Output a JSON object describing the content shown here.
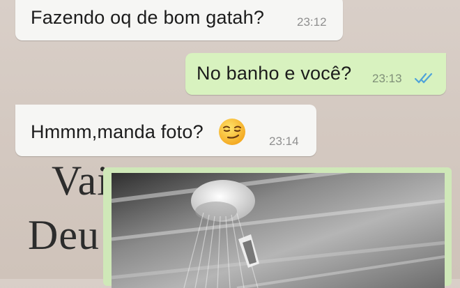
{
  "chat": {
    "messages": [
      {
        "direction": "incoming",
        "text": "Fazendo oq de bom gatah?",
        "time": "23:12"
      },
      {
        "direction": "outgoing",
        "text": "No banho e você?",
        "time": "23:13",
        "status_icon": "double-check-icon",
        "status_color": "#4fa3d9"
      },
      {
        "direction": "incoming",
        "text": "Hmmm,manda foto?",
        "time": "23:14",
        "emoji_icon": "smirking-face-emoji"
      }
    ],
    "background_text": [
      "Vai",
      "Deu"
    ],
    "image_message": {
      "content": "photo of shower head spraying water"
    }
  },
  "colors": {
    "incoming_bubble": "#f6f6f4",
    "outgoing_bubble": "#d8f2bf",
    "background": "#d4c9c1"
  }
}
